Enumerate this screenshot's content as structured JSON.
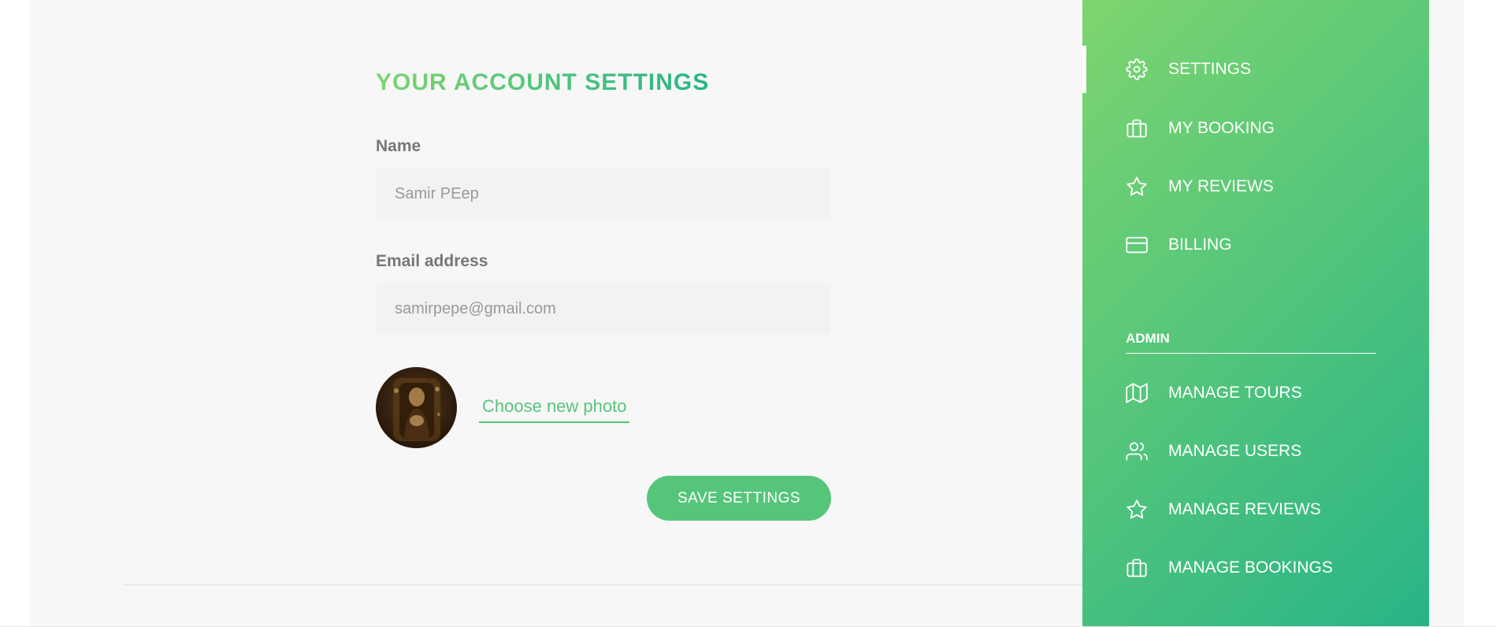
{
  "page": {
    "title": "Your account settings",
    "accent_color": "#55c57a",
    "gradient_start": "#7dd56f",
    "gradient_end": "#28b487"
  },
  "form": {
    "name_label": "Name",
    "name_value": "Samir PEep",
    "email_label": "Email address",
    "email_value": "samirpepe@gmail.com",
    "photo_link": "Choose new photo",
    "save_button": "Save settings"
  },
  "sidebar": {
    "items": [
      {
        "label": "Settings",
        "icon": "settings-icon",
        "active": true
      },
      {
        "label": "My booking",
        "icon": "briefcase-icon"
      },
      {
        "label": "My reviews",
        "icon": "star-icon"
      },
      {
        "label": "Billing",
        "icon": "credit-card-icon"
      }
    ],
    "admin_heading": "Admin",
    "admin_items": [
      {
        "label": "Manage tours",
        "icon": "map-icon"
      },
      {
        "label": "Manage users",
        "icon": "users-icon"
      },
      {
        "label": "Manage reviews",
        "icon": "star-icon"
      },
      {
        "label": "Manage bookings",
        "icon": "briefcase-icon"
      }
    ]
  }
}
